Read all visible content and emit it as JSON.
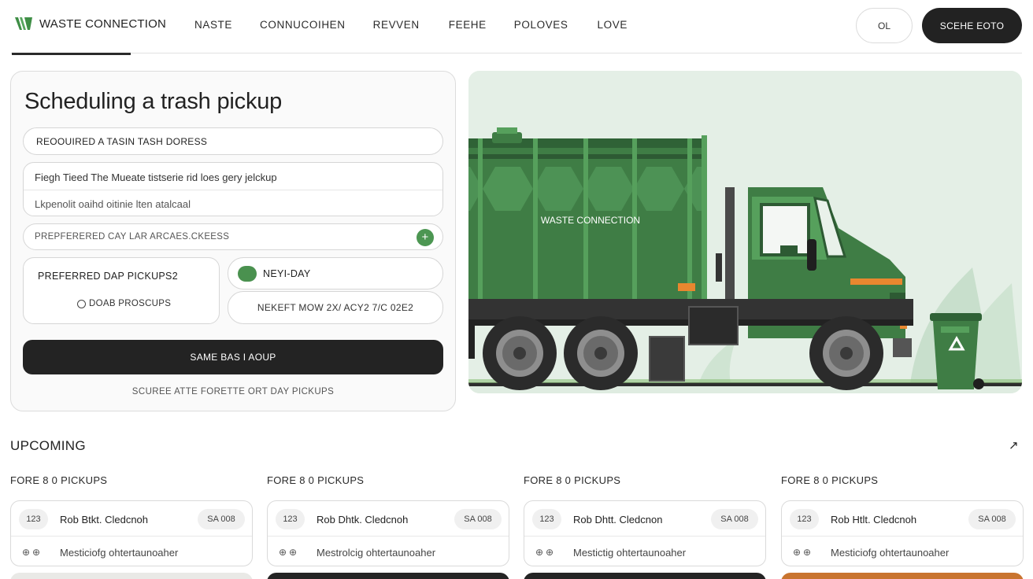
{
  "nav": {
    "brand": "WASTE CONNECTION",
    "links": [
      "NASTE",
      "CONNUCOIHEN",
      "REVVEN",
      "FEEHE",
      "POLOVES",
      "LOVE"
    ],
    "ghost_button": "OL",
    "primary_button": "SCEHE EOTO"
  },
  "form": {
    "title": "Scheduling a trash pickup",
    "address_field": "REOOUIRED A TASIN TASH DORESS",
    "notes_line1": "Fiegh Tieed The Mueate tistserie rid loes gery jelckup",
    "notes_line2": "Lkpenolit oaihd oitinie lten atalcaal",
    "day_field": "PREPFERERED CAY LAR ARCAES.CKEESS",
    "add_button": "+",
    "preferred_label": "PREFERRED DAP PICKUPS2",
    "preferred_option": "DOAB PROSCUPS",
    "next_day": "NEYI-DAY",
    "time_slot": "NEKEFT MOW 2X/ ACY2 7/C 02E2",
    "submit": "SAME BAS I AOUP",
    "footnote": "SCUREE ATTE FORETTE ORT DAY PICKUPS"
  },
  "hero": {
    "truck_text": "WASTE CONNECTION",
    "colors": {
      "background": "#e4efe6",
      "truck_green": "#3f7d45",
      "accent_orange": "#e8872f"
    }
  },
  "upcoming": {
    "title": "UPCOMING",
    "arrow_icon": "arrow-up-right-icon",
    "columns": [
      {
        "label": "FORE 8 0 PICKUPS",
        "number": "123",
        "name": "Rob Btkt. Cledcnoh",
        "code": "SA 008",
        "icons": "⊕⊕",
        "meta": "Mesticiofg ohtertaunoaher",
        "bottom_color": "#e9e9e6"
      },
      {
        "label": "FORE 8 0 PICKUPS",
        "number": "123",
        "name": "Rob Dhtk. Cledcnoh",
        "code": "SA 008",
        "icons": "⊕⊕",
        "meta": "Mestrolcig ohtertaunoaher",
        "bottom_color": "#242424"
      },
      {
        "label": "FORE 8 0 PICKUPS",
        "number": "123",
        "name": "Rob Dhtt. Cledcnon",
        "code": "SA 008",
        "icons": "⊕⊕",
        "meta": "Mestictig ohtertaunoaher",
        "bottom_color": "#242424"
      },
      {
        "label": "FORE 8 0 PICKUPS",
        "number": "123",
        "name": "Rob Htlt. Cledcnoh",
        "code": "SA 008",
        "icons": "⊕⊕",
        "meta": "Mesticiofg ohtertaunoaher",
        "bottom_color": "#c9742f"
      }
    ]
  }
}
